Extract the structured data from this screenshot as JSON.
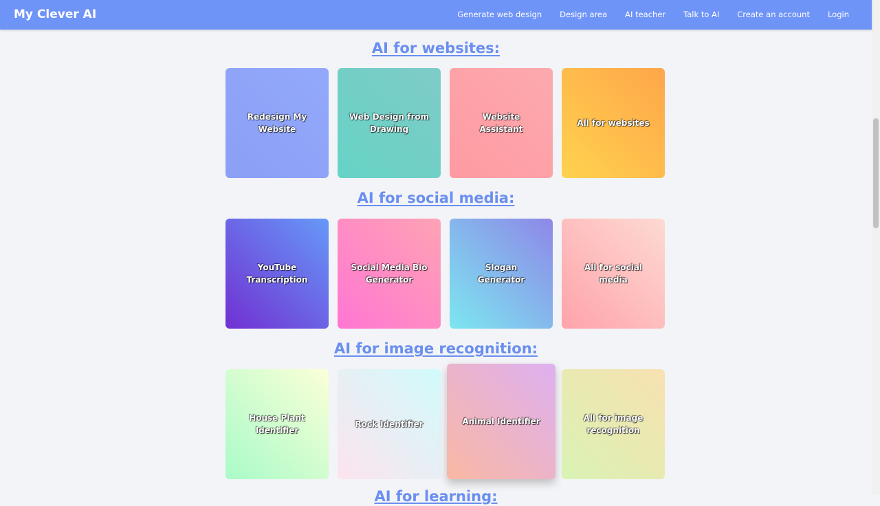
{
  "navbar": {
    "brand": "My Clever AI",
    "links": [
      "Generate web design",
      "Design area",
      "AI teacher",
      "Talk to AI",
      "Create an account",
      "Login"
    ]
  },
  "sections": [
    {
      "title": "AI for websites:",
      "cards": [
        {
          "label": "Redesign My Website",
          "gradient": [
            "#8b9ff5",
            "#93a9fb"
          ]
        },
        {
          "label": "Web Design from Drawing",
          "gradient": [
            "#66d3c6",
            "#7fcbc7"
          ]
        },
        {
          "label": "Website Assistant",
          "gradient": [
            "#ff9aa2",
            "#fcaaae"
          ]
        },
        {
          "label": "All for websites",
          "gradient": [
            "#ffd24f",
            "#ffa649"
          ]
        }
      ]
    },
    {
      "title": "AI for social media:",
      "cards": [
        {
          "label": "YouTube Transcription",
          "gradient": [
            "#7130d2",
            "#6699f8"
          ]
        },
        {
          "label": "Social Media Bio Generator",
          "gradient": [
            "#ff76d3",
            "#ffa3b5"
          ]
        },
        {
          "label": "Slogan Generator",
          "gradient": [
            "#7ce7f0",
            "#8e87e8"
          ]
        },
        {
          "label": "All for social media",
          "gradient": [
            "#ffa3ab",
            "#fddad2"
          ]
        }
      ]
    },
    {
      "title": "AI for image recognition:",
      "cards": [
        {
          "label": "House Plant Identifier",
          "gradient": [
            "#a9fbc8",
            "#fbffd7"
          ]
        },
        {
          "label": "Rock Identifier",
          "gradient": [
            "#fde3ee",
            "#d1fbfb"
          ]
        },
        {
          "label": "Animal Identifier",
          "gradient": [
            "#f9b8a3",
            "#deb0f1"
          ]
        },
        {
          "label": "All for image recognition",
          "gradient": [
            "#d9f3b3",
            "#f8e1b2"
          ]
        }
      ]
    }
  ],
  "next_section_title": "AI for learning:"
}
